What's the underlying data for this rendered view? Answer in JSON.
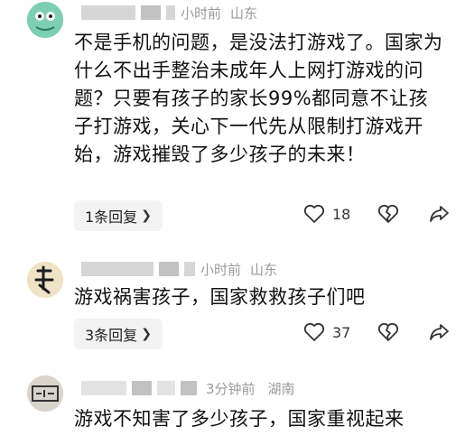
{
  "comments": [
    {
      "meta": "小时前",
      "location": "山东",
      "text": "不是手机的问题，是没法打游戏了。国家为什么不出手整治未成年人上网打游戏的问题？只要有孩子的家长99%都同意不让孩子打游戏，关心下一代先从限制打游戏开始，游戏摧毁了多少孩子的未来！",
      "replies": "1条回复",
      "likes": "18",
      "avatar_icon": "dinosaur-avatar-icon"
    },
    {
      "meta": "小时前",
      "location": "山东",
      "text": "游戏祸害孩子，国家救救孩子们吧",
      "replies": "3条回复",
      "likes": "37",
      "avatar_icon": "calligraphy-avatar-icon"
    },
    {
      "meta": "3分钟前",
      "location": "湖南",
      "text": "游戏不知害了多少孩子，国家重视起来",
      "avatar_icon": "stamp-avatar-icon"
    }
  ],
  "colors": {
    "meta": "#999999",
    "text": "#111111",
    "reply_bg": "#f3f3f3"
  }
}
